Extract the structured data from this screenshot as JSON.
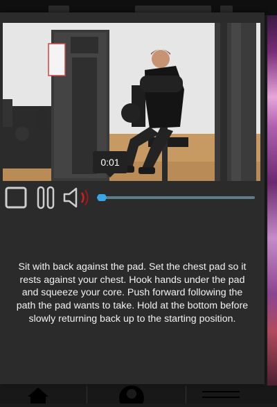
{
  "player": {
    "current_time": "0:01",
    "progress": 0.03
  },
  "exercise": {
    "description": "Sit with back against the pad. Set the chest pad so it rests against your chest. Hook hands under the pad and squeeze your core. Push forward following the path the pad wants to take. Hold at the bottom before slowly returning back up to the starting position."
  },
  "colors": {
    "accent": "#3aa6e8",
    "mute_indicator": "#d02020",
    "dialog_bg": "#2b2b2b",
    "text": "#f2f2f2"
  },
  "icons": {
    "stop": "stop-icon",
    "pause": "pause-icon",
    "volume": "volume-icon",
    "home": "home-icon",
    "profile": "profile-icon",
    "menu": "menu-icon"
  }
}
